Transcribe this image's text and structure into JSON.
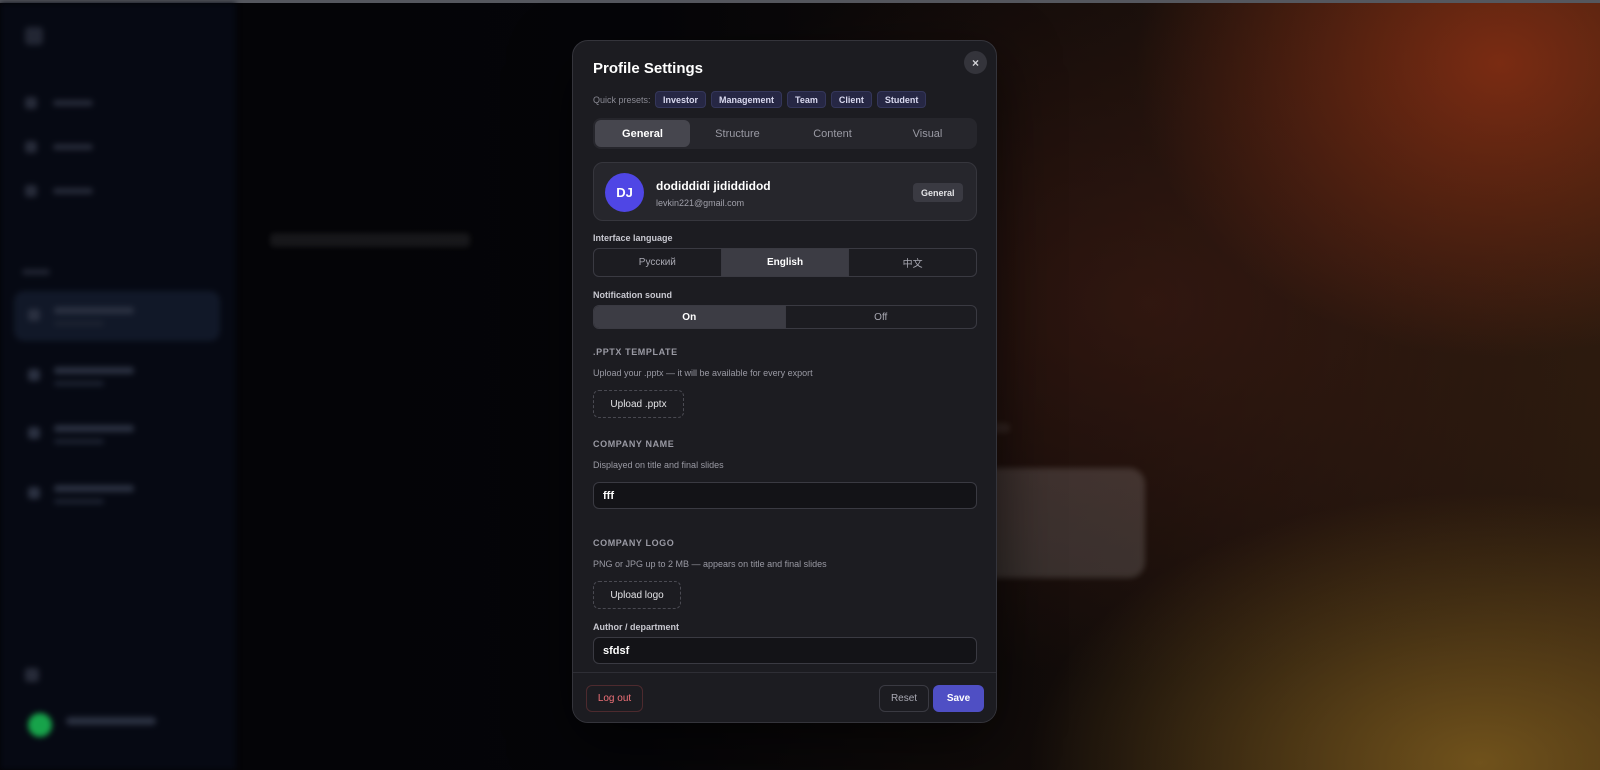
{
  "modal": {
    "title": "Profile Settings",
    "close_symbol": "×",
    "close_icon": "close-icon"
  },
  "presets": {
    "label": "Quick presets:",
    "items": [
      "Investor",
      "Management",
      "Team",
      "Client",
      "Student"
    ]
  },
  "tabs": {
    "items": [
      "General",
      "Structure",
      "Content",
      "Visual"
    ],
    "active": "General"
  },
  "profile": {
    "initials": "DJ",
    "name": "dodiddidi jididdidod",
    "email": "levkin221@gmail.com",
    "badge": "General",
    "avatar_color": "#4f46e5"
  },
  "language": {
    "label": "Interface language",
    "options": [
      "Русский",
      "English",
      "中文"
    ],
    "selected": "English"
  },
  "notification": {
    "label": "Notification sound",
    "options": [
      "On",
      "Off"
    ],
    "selected": "On"
  },
  "pptx": {
    "heading": ".PPTX TEMPLATE",
    "description": "Upload your .pptx — it will be available for every export",
    "button": "Upload .pptx"
  },
  "company_name": {
    "heading": "COMPANY NAME",
    "description": "Displayed on title and final slides",
    "value": "fff"
  },
  "company_logo": {
    "heading": "COMPANY LOGO",
    "description": "PNG or JPG up to 2 MB — appears on title and final slides",
    "button": "Upload logo"
  },
  "author": {
    "label": "Author / department",
    "value": "sfdsf"
  },
  "footer": {
    "logout": "Log out",
    "reset": "Reset",
    "save": "Save"
  },
  "colors": {
    "accent": "#4f4fc4",
    "danger": "#f07178",
    "modal_bg": "#1c1c21"
  }
}
